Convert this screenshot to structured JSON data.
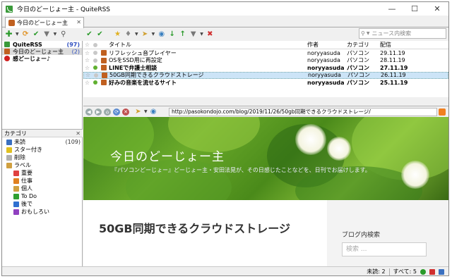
{
  "window": {
    "title": "今日のどーじょー主 - QuiteRSS"
  },
  "tab": {
    "label": "今日のどーじょー主"
  },
  "search": {
    "placeholder": "ニュース内検索"
  },
  "feeds": [
    {
      "name": "QuiteRSS",
      "count": "(97)",
      "bold": true
    },
    {
      "name": "今日のどーじょー主",
      "count": "(2)",
      "bold": false
    },
    {
      "name": "感どーじょー♪",
      "count": "",
      "bold": true
    }
  ],
  "categories_panel": {
    "title": "カテゴリ",
    "items": [
      {
        "label": "未読",
        "count": "(109)",
        "color": "#3a70c0",
        "indent": 0
      },
      {
        "label": "スター付き",
        "count": "",
        "color": "#e0c020",
        "indent": 0
      },
      {
        "label": "削除",
        "count": "",
        "color": "#b0b0b0",
        "indent": 0
      },
      {
        "label": "ラベル",
        "count": "",
        "color": "#d0a040",
        "indent": 0
      },
      {
        "label": "重要",
        "count": "",
        "color": "#e04040",
        "indent": 1
      },
      {
        "label": "仕事",
        "count": "",
        "color": "#e08020",
        "indent": 1
      },
      {
        "label": "個人",
        "count": "",
        "color": "#d0a040",
        "indent": 1
      },
      {
        "label": "To Do",
        "count": "",
        "color": "#30a030",
        "indent": 1
      },
      {
        "label": "後で",
        "count": "",
        "color": "#3070d0",
        "indent": 1
      },
      {
        "label": "おもしろい",
        "count": "",
        "color": "#9040c0",
        "indent": 1
      }
    ]
  },
  "news_list": {
    "headers": {
      "title": "タイトル",
      "author": "作者",
      "category": "カテゴリ",
      "date": "配信"
    },
    "rows": [
      {
        "title": "リフレッシュ音プレイヤー",
        "author": "noryyasuda",
        "category": "パソコン",
        "date": "29.11.19",
        "read": true,
        "selected": false,
        "dot": "#c8c8c8"
      },
      {
        "title": "OSをSSD用に再設定",
        "author": "noryyasuda",
        "category": "パソコン",
        "date": "28.11.19",
        "read": true,
        "selected": false,
        "dot": "#c8c8c8"
      },
      {
        "title": "LINEで弁護士相談",
        "author": "noryyasuda",
        "category": "パソコン",
        "date": "27.11.19",
        "read": false,
        "selected": false,
        "dot": "#60b030"
      },
      {
        "title": "50GB同期できるクラウドストレージ",
        "author": "noryyasuda",
        "category": "パソコン",
        "date": "26.11.19",
        "read": true,
        "selected": true,
        "dot": "#c8c8c8"
      },
      {
        "title": "好みの音楽を流せるサイト",
        "author": "noryyasuda",
        "category": "パソコン",
        "date": "25.11.19",
        "read": false,
        "selected": false,
        "dot": "#60b030"
      }
    ]
  },
  "browser": {
    "url": "http://pasokondojo.com/blog/2019/11/26/50gb同期できるクラウドストレージ/"
  },
  "webpage": {
    "site_title": "今日のどーじょー主",
    "site_description": "『パソコンどーじょー』どーじょー主・安田法晃が、その日感じたことなどを、日刊でお届けします。",
    "post_title": "50GB同期できるクラウドストレージ",
    "sidebar_heading": "ブログ内検索",
    "sidebar_search_placeholder": "検索 ..."
  },
  "statusbar": {
    "unread_label": "未読: 2",
    "total_label": "すべて: 5"
  }
}
